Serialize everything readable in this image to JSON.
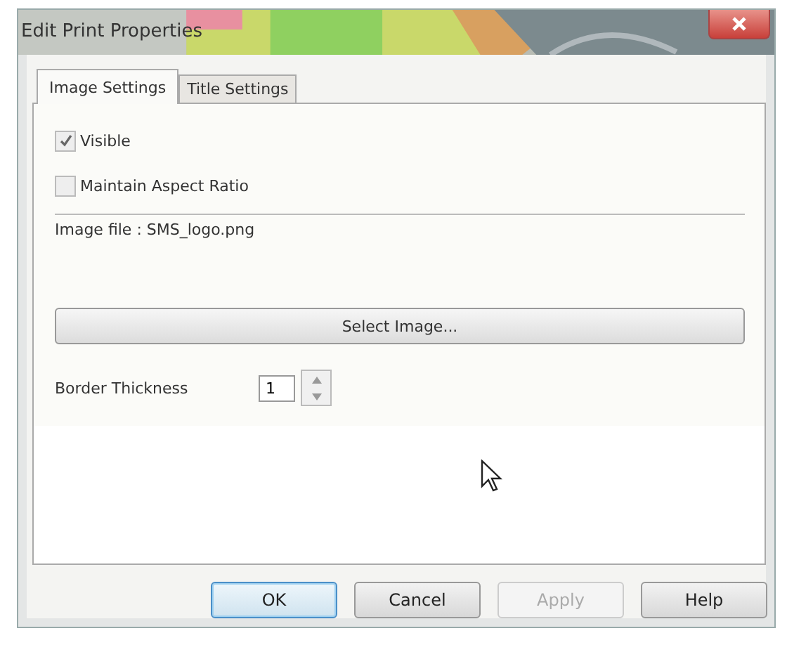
{
  "window": {
    "title": "Edit Print Properties"
  },
  "tabs": [
    {
      "label": "Image Settings",
      "selected": true
    },
    {
      "label": "Title Settings",
      "selected": false
    }
  ],
  "checkboxes": [
    {
      "label": "Visible",
      "checked": true
    },
    {
      "label": "Maintain Aspect Ratio",
      "checked": false
    }
  ],
  "image_file": {
    "text": "Image file : SMS_logo.png"
  },
  "select_button": "Select Image...",
  "border_thickness": {
    "label": "Border Thickness",
    "value": "1"
  },
  "buttons": [
    {
      "label": "OK",
      "default": true,
      "disabled": false
    },
    {
      "label": "Cancel",
      "default": false,
      "disabled": false
    },
    {
      "label": "Apply",
      "default": false,
      "disabled": true
    },
    {
      "label": "Help",
      "default": false,
      "disabled": false
    }
  ]
}
